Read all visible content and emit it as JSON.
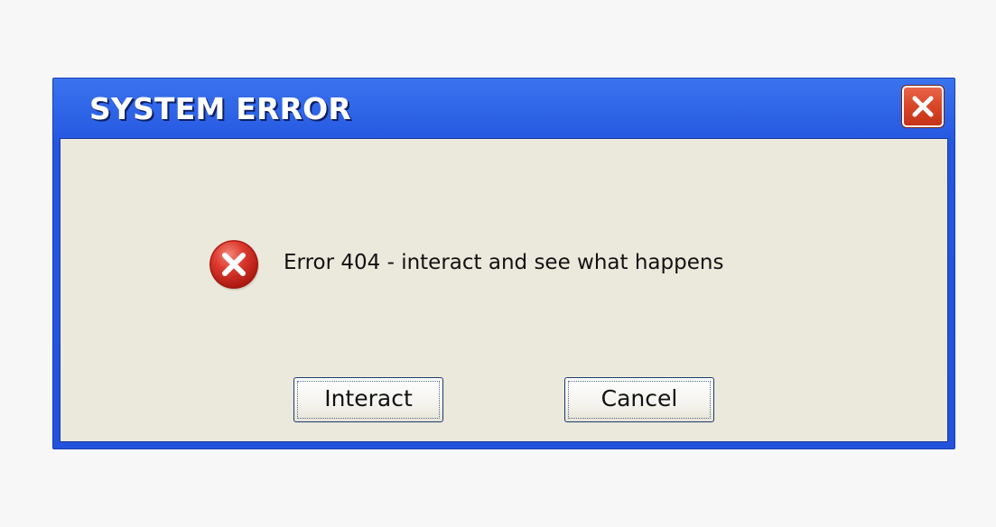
{
  "dialog": {
    "title": "SYSTEM ERROR",
    "message": "Error 404 - interact and see what happens",
    "icon": "error-icon",
    "buttons": {
      "interact": "Interact",
      "cancel": "Cancel"
    },
    "close_icon": "close-icon"
  },
  "colors": {
    "titlebar": "#2456e0",
    "client_background": "#ebe8dc",
    "close_button": "#d9482b",
    "error_icon": "#d9342a",
    "page_background": "#f7f7f7"
  }
}
